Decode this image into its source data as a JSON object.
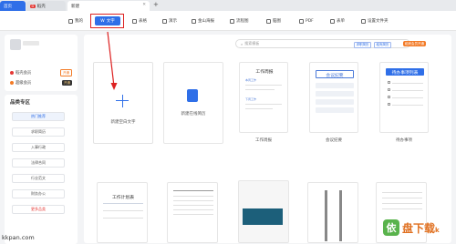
{
  "tabs": [
    {
      "label": "首页"
    },
    {
      "label": "稻壳",
      "tag": "D"
    },
    {
      "label": "新建"
    }
  ],
  "toolbar": {
    "items": [
      {
        "label": "我的"
      },
      {
        "label": "文字"
      },
      {
        "label": "表格"
      },
      {
        "label": "演示"
      },
      {
        "label": "金山海报"
      },
      {
        "label": "流程图"
      },
      {
        "label": "脑图"
      },
      {
        "label": "PDF"
      },
      {
        "label": "表单"
      },
      {
        "label": "设置文件夹"
      }
    ]
  },
  "sidebar": {
    "members": [
      {
        "label": "稻壳会员",
        "badge": "开通",
        "color": "#e53935",
        "badge_color": "#f37b27"
      },
      {
        "label": "超级会员",
        "badge": "开通",
        "color": "#f37b27",
        "badge_color": "#333333"
      }
    ],
    "zone_title": "品类专区",
    "items": [
      {
        "label": "热门推荐"
      },
      {
        "label": "求职简历"
      },
      {
        "label": "入事行政"
      },
      {
        "label": "法律合同"
      },
      {
        "label": "行业范文"
      },
      {
        "label": "财务办公"
      },
      {
        "label": "更多品类"
      }
    ]
  },
  "search": {
    "placeholder": "搜索模板",
    "btn1": "求职简历",
    "btn2": "稻壳简历",
    "hot": "稻壳会员开通"
  },
  "cards": {
    "new_blank": "新建空白文字",
    "new_resume": "新建在线简历",
    "work_report": {
      "title": "工作周报",
      "caption": "工作周报",
      "label1": "本周工作",
      "label2": "下周工作"
    },
    "meeting": {
      "title": "会议纪要",
      "caption": "会议纪要"
    },
    "todo": {
      "title": "待办事项列表",
      "caption": "待办事项"
    },
    "work_plan": {
      "title": "工作计划表"
    }
  },
  "watermark": "kkpan.com",
  "logo": {
    "mark": "依",
    "text": "盘下载",
    "sub": "k"
  }
}
